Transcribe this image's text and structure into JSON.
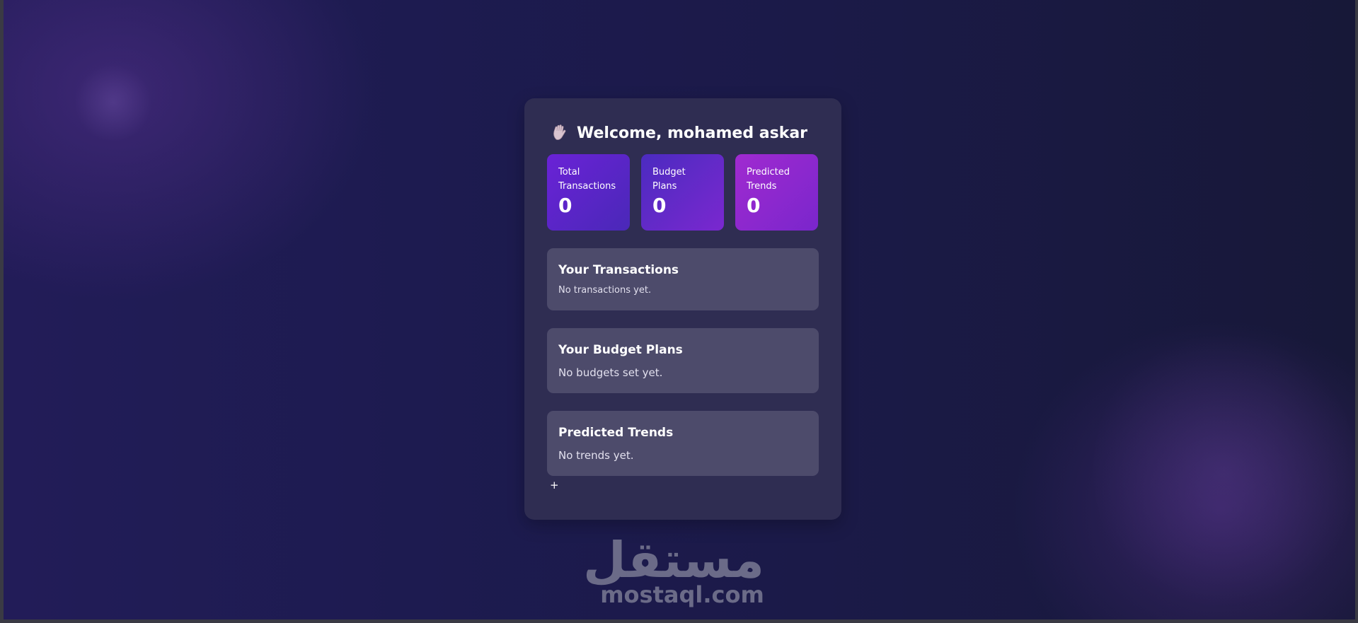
{
  "header": {
    "welcome_text": "Welcome, mohamed askar",
    "icon": "waving-hand-icon"
  },
  "stats": [
    {
      "label": "Total Transactions",
      "value": "0"
    },
    {
      "label": "Budget Plans",
      "value": "0"
    },
    {
      "label": "Predicted Trends",
      "value": "0"
    }
  ],
  "sections": {
    "transactions": {
      "title": "Your Transactions",
      "empty_text": "No transactions yet."
    },
    "budgets": {
      "title": "Your Budget Plans",
      "empty_text": "No budgets set yet."
    },
    "trends": {
      "title": "Predicted Trends",
      "empty_text": "No trends yet."
    }
  },
  "add_symbol": "+",
  "watermark": {
    "arabic": "مستقل",
    "latin": "mostaql.com"
  },
  "colors": {
    "card_bg": "#2f2d52",
    "section_bg": "#4d4b6b",
    "stat_purple": "#6a22d6",
    "stat_magenta": "#a02ad0"
  }
}
